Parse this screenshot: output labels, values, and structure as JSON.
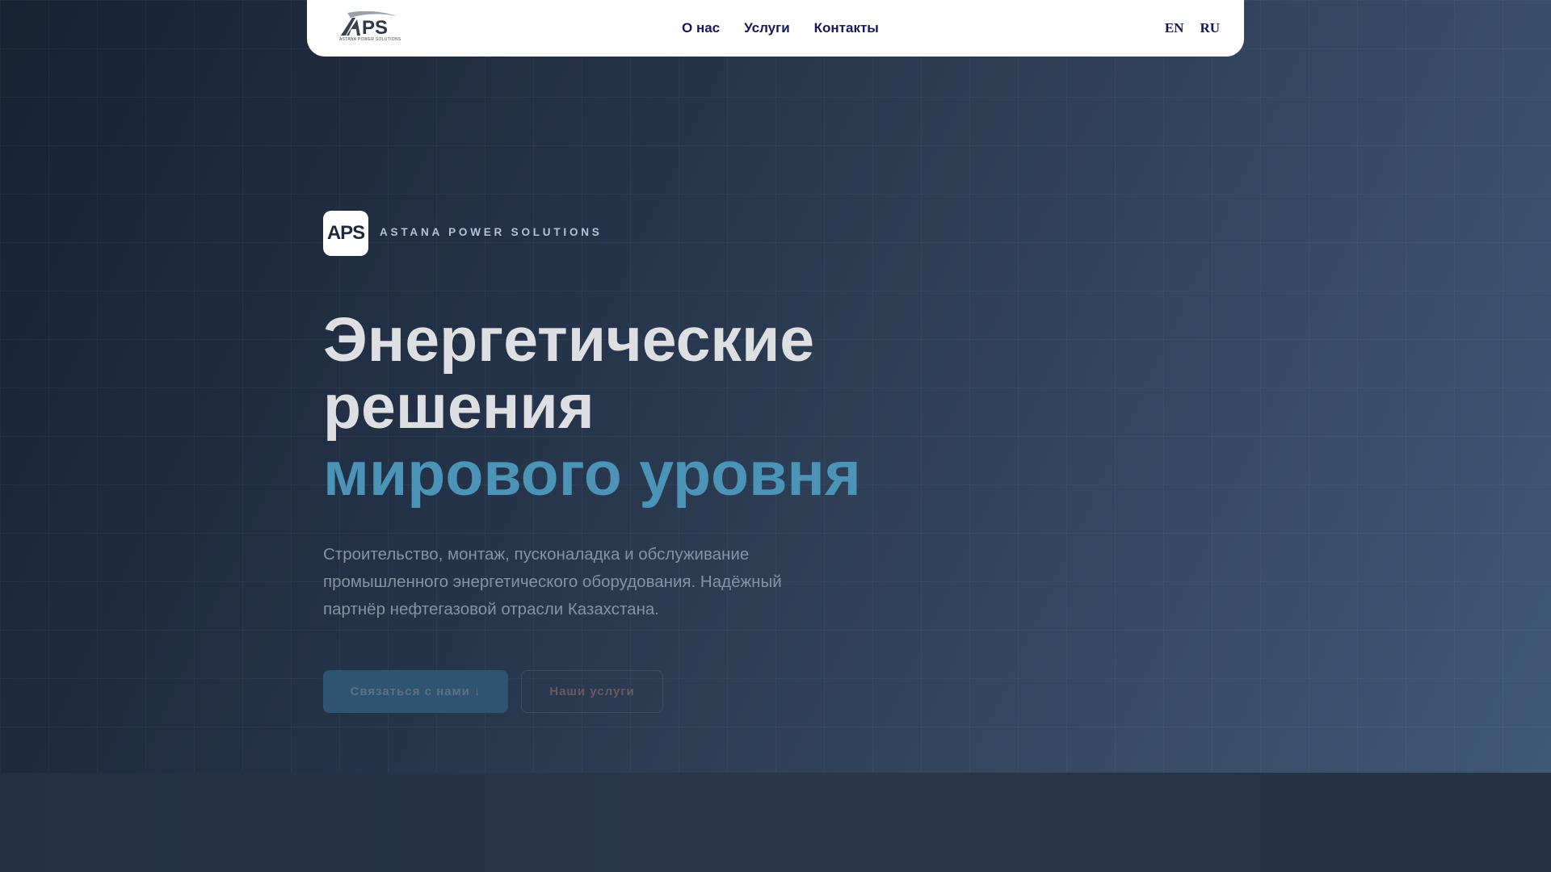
{
  "nav": {
    "logo_text": "APS",
    "logo_subtitle": "ASTANA POWER SOLUTIONS",
    "links": [
      {
        "label": "О нас"
      },
      {
        "label": "Услуги"
      },
      {
        "label": "Контакты"
      }
    ],
    "languages": [
      {
        "label": "EN"
      },
      {
        "label": "RU"
      }
    ]
  },
  "hero": {
    "badge": "APS",
    "brand": "ASTANA POWER SOLUTIONS",
    "title_line1": "Энергетические",
    "title_line2": "решения",
    "title_accent": "мирового уровня",
    "lead": "Строительство, монтаж, пусконаладка и обслуживание промышленного энергетического оборудования. Надёжный партнёр нефтегазовой отрасли Казахстана.",
    "primary_button": "Связаться с нами ↓",
    "secondary_button": "Наши услуги"
  },
  "colors": {
    "accent": "#4c93b8",
    "nav_text": "#16185a"
  }
}
